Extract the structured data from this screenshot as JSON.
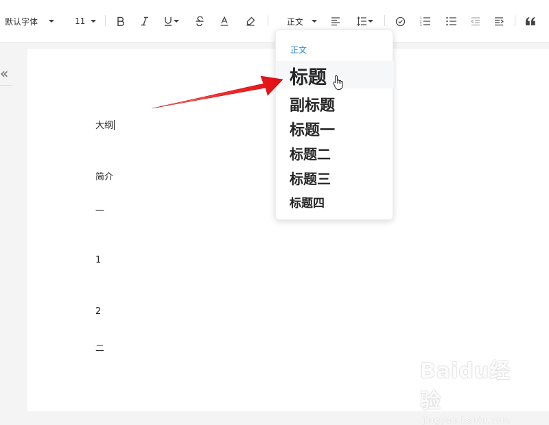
{
  "toolbar": {
    "font_family": "默认字体",
    "font_size": "11",
    "paragraph_style": "正文"
  },
  "icons": [
    "bold-icon",
    "italic-icon",
    "underline-icon",
    "strikethrough-icon",
    "font-color-icon",
    "highlight-icon",
    "align-left-icon",
    "line-spacing-icon",
    "task-list-icon",
    "ordered-list-icon",
    "bullet-list-icon",
    "outdent-icon",
    "indent-icon",
    "quote-icon",
    "collapse-sidebar-icon"
  ],
  "sidebar": {
    "toggle_icon": "«"
  },
  "document": {
    "paragraphs": [
      "大纲",
      "简介",
      "一",
      "1",
      "2",
      "二"
    ]
  },
  "dropdown": {
    "current": "正文",
    "options": [
      "标题",
      "副标题",
      "标题一",
      "标题二",
      "标题三",
      "标题四"
    ]
  },
  "colors": {
    "accent": "#2b8ad9",
    "arrow": "#e8161b"
  },
  "watermark": {
    "logo": "Baidu经验",
    "url": "jingyan.baidu.com"
  }
}
